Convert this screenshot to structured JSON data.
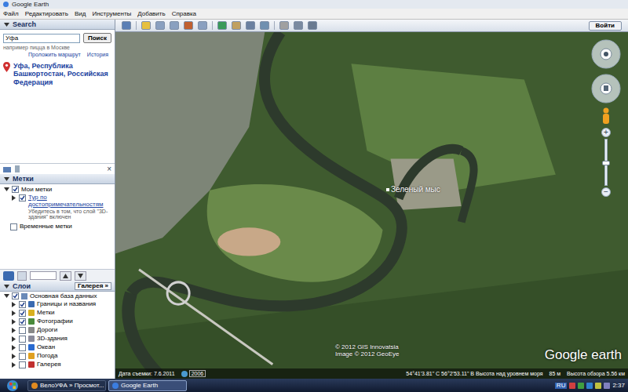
{
  "window": {
    "title": "Google Earth"
  },
  "menu": [
    "Файл",
    "Редактировать",
    "Вид",
    "Инструменты",
    "Добавить",
    "Справка"
  ],
  "toolbar": {
    "sign_in": "Войти"
  },
  "search": {
    "header": "Search",
    "value": "Уфа",
    "button": "Поиск",
    "hint": "например пицца в Москве",
    "links": [
      "Проложить маршрут",
      "История"
    ],
    "result": "Уфа, Республика Башкортостан, Российская Федерация"
  },
  "places": {
    "header": "Метки",
    "close": "×",
    "my_places": {
      "label": "Мои метки",
      "checked": true,
      "expanded": true,
      "children": [
        {
          "label": "Тур по достопримечательностям",
          "checked": true,
          "note": "Убедитесь в том, что слой \"3D-здания\" включен"
        }
      ]
    },
    "temporary": {
      "label": "Временные метки",
      "checked": false
    }
  },
  "layers": {
    "header": "Слои",
    "gallery_button": "Галерея »",
    "root": {
      "label": "Основная база данных",
      "checked": true,
      "expanded": true
    },
    "items": [
      {
        "label": "Границы и названия",
        "checked": true,
        "color": "#3a6ab0"
      },
      {
        "label": "Метки",
        "checked": true,
        "color": "#d8b020"
      },
      {
        "label": "Фотографии",
        "checked": true,
        "color": "#4a8a3a"
      },
      {
        "label": "Дороги",
        "checked": false,
        "color": "#888888"
      },
      {
        "label": "3D-здания",
        "checked": false,
        "color": "#8a8a9a"
      },
      {
        "label": "Океан",
        "checked": false,
        "color": "#2a6ad0"
      },
      {
        "label": "Погода",
        "checked": false,
        "color": "#e0a020"
      },
      {
        "label": "Галерея",
        "checked": false,
        "color": "#c03030"
      }
    ]
  },
  "map": {
    "label": "Зеленый мыс",
    "copyright": [
      "© 2012 GIS Innovatsia",
      "Image © 2012 GeoEye"
    ],
    "logo": "Google earth",
    "zoom": {
      "plus": "+",
      "minus": "−",
      "level": 0.5
    },
    "status": {
      "date": "Дата съемки: 7.6.2011",
      "year": "2006",
      "coords": "54°41'3.81\" С  56°2'53.11\" В  Высота над уровнем моря",
      "elevation": "85 м",
      "eye": "Высота обзора 5.56 км"
    }
  },
  "taskbar": {
    "tasks": [
      {
        "label": "ВелоУФА » Просмот...",
        "selected": false
      },
      {
        "label": "Google Earth",
        "selected": true
      }
    ],
    "lang": "RU",
    "time": "2:37"
  }
}
